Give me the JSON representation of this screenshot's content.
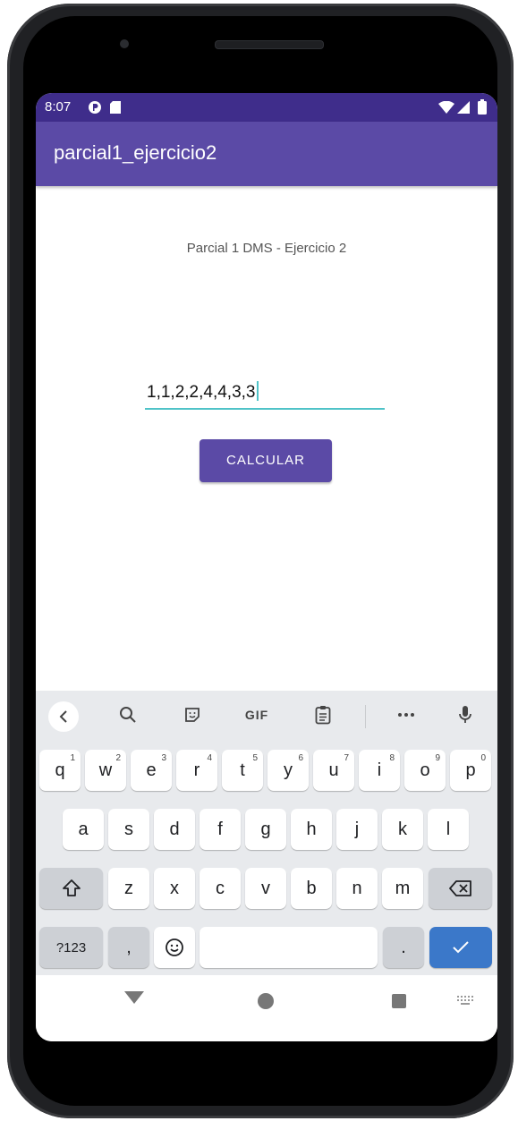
{
  "status_bar": {
    "time": "8:07"
  },
  "app_bar": {
    "title": "parcial1_ejercicio2"
  },
  "content": {
    "subtitle": "Parcial 1 DMS - Ejercicio 2",
    "input_value": "1,1,2,2,4,4,3,3",
    "calculate_label": "CALCULAR"
  },
  "keyboard": {
    "toolbar": {
      "gif_label": "GIF"
    },
    "row1": [
      {
        "key": "q",
        "hint": "1"
      },
      {
        "key": "w",
        "hint": "2"
      },
      {
        "key": "e",
        "hint": "3"
      },
      {
        "key": "r",
        "hint": "4"
      },
      {
        "key": "t",
        "hint": "5"
      },
      {
        "key": "y",
        "hint": "6"
      },
      {
        "key": "u",
        "hint": "7"
      },
      {
        "key": "i",
        "hint": "8"
      },
      {
        "key": "o",
        "hint": "9"
      },
      {
        "key": "p",
        "hint": "0"
      }
    ],
    "row2": [
      "a",
      "s",
      "d",
      "f",
      "g",
      "h",
      "j",
      "k",
      "l"
    ],
    "row3": [
      "z",
      "x",
      "c",
      "v",
      "b",
      "n",
      "m"
    ],
    "row4": {
      "symbols": "?123",
      "comma": ",",
      "period": "."
    }
  },
  "colors": {
    "status_bar": "#3f2d8b",
    "app_bar": "#5b4aa6",
    "accent": "#4fc3c8",
    "button": "#5b4aa6",
    "enter_key": "#3b78c9"
  }
}
